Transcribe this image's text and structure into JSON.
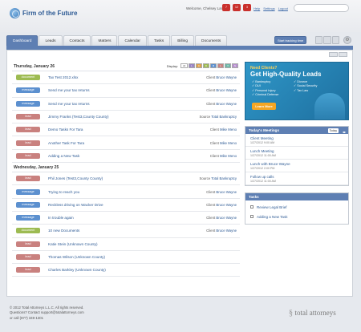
{
  "header": {
    "logo_text": "Firm of the Future",
    "welcome": "Welcome, Chelsey Lambert",
    "notifications": [
      "7",
      "12",
      "3"
    ],
    "links": [
      "Help",
      "Settings",
      "Logout"
    ],
    "search_placeholder": ""
  },
  "nav": {
    "tabs": [
      "Dashboard",
      "Leads",
      "Contacts",
      "Matters",
      "Calendar",
      "Tasks",
      "Billing",
      "Documents"
    ],
    "active": "Dashboard",
    "tracking_button": "Start tracking time"
  },
  "feed": {
    "display_label": "Display:",
    "filters": [
      {
        "label": "All",
        "color": "#ffffff"
      },
      {
        "label": "L",
        "color": "#9a84c4"
      },
      {
        "label": "C",
        "color": "#e0a24a"
      },
      {
        "label": "D",
        "color": "#9dbb52"
      },
      {
        "label": "M",
        "color": "#5c90cf"
      },
      {
        "label": "L",
        "color": "#c9817f"
      },
      {
        "label": "T",
        "color": "#6fb8a8"
      },
      {
        "label": "N",
        "color": "#b88fd0"
      }
    ],
    "days": [
      {
        "label": "Thursday, January 26",
        "items": [
          {
            "type": "document",
            "title": "Tax Test 2012.xlsx",
            "meta_label": "Client",
            "meta_value": "Bruce Wayne"
          },
          {
            "type": "message",
            "title": "Send me your tax returns",
            "meta_label": "Client",
            "meta_value": "Bruce Wayne"
          },
          {
            "type": "message",
            "title": "Send me your tax returns",
            "meta_label": "Client",
            "meta_value": "Bruce Wayne"
          },
          {
            "type": "lead",
            "title": "Jimmy Franks (Test3,County County)",
            "meta_label": "Source",
            "meta_value": "Total Bankruptcy"
          },
          {
            "type": "lead",
            "title": "Demo Tasks For Tara",
            "meta_label": "Client",
            "meta_value": "Mike Meno"
          },
          {
            "type": "lead",
            "title": "Another Task For Tara",
            "meta_label": "Client",
            "meta_value": "Mike Meno"
          },
          {
            "type": "lead",
            "title": "Adding a New Task",
            "meta_label": "Client",
            "meta_value": "Mike Meno"
          }
        ]
      },
      {
        "label": "Wednesday, January 25",
        "items": [
          {
            "type": "lead",
            "title": "Phil Jones (Test3,County County)",
            "meta_label": "Source",
            "meta_value": "Total Bankruptcy"
          },
          {
            "type": "message",
            "title": "Trying to reach you",
            "meta_label": "Client",
            "meta_value": "Bruce Wayne"
          },
          {
            "type": "message",
            "title": "Reckless driving on Wacker Drive",
            "meta_label": "Client",
            "meta_value": "Bruce Wayne"
          },
          {
            "type": "message",
            "title": "In trouble again",
            "meta_label": "Client",
            "meta_value": "Bruce Wayne"
          },
          {
            "type": "document",
            "title": "10 new Documents",
            "meta_label": "Client",
            "meta_value": "Bruce Wayne"
          },
          {
            "type": "lead",
            "title": "Katie Stein (Unknown County)",
            "meta_label": "",
            "meta_value": ""
          },
          {
            "type": "lead",
            "title": "Thomas Wilson (Unknown County)",
            "meta_label": "",
            "meta_value": ""
          },
          {
            "type": "lead",
            "title": "Charles Barkley (Unknown County)",
            "meta_label": "",
            "meta_value": ""
          }
        ]
      }
    ]
  },
  "ad": {
    "need": "Need Clients?",
    "headline": "Get High-Quality Leads",
    "items_left": [
      "Bankruptcy",
      "DUI",
      "Personal Injury",
      "Criminal Defense"
    ],
    "items_right": [
      "Divorce",
      "Social Security",
      "Tax Law"
    ],
    "cta": "Learn More"
  },
  "meetings": {
    "title": "Today's Meetings",
    "today_button": "Today",
    "items": [
      {
        "title": "Client Meeting",
        "time": "1/27/2012 9:00 AM"
      },
      {
        "title": "Lunch Meeting",
        "time": "1/27/2012 11:00 AM"
      },
      {
        "title": "Lunch with Bruce Wayne",
        "time": "1/27/2012 2:00 PM"
      },
      {
        "title": "Follow up calls",
        "time": "1/27/2012 11:00 AM"
      }
    ]
  },
  "tasks": {
    "title": "Tasks",
    "items": [
      "Review Legal Brief",
      "Adding a New Task"
    ]
  },
  "footer": {
    "lines": [
      "© 2012 Total Attorneys L.L.C. All rights reserved.",
      "Questions? Contact support@totalattorneys.com",
      "or call (877) 349-1301"
    ],
    "brand": "total attorneys"
  }
}
